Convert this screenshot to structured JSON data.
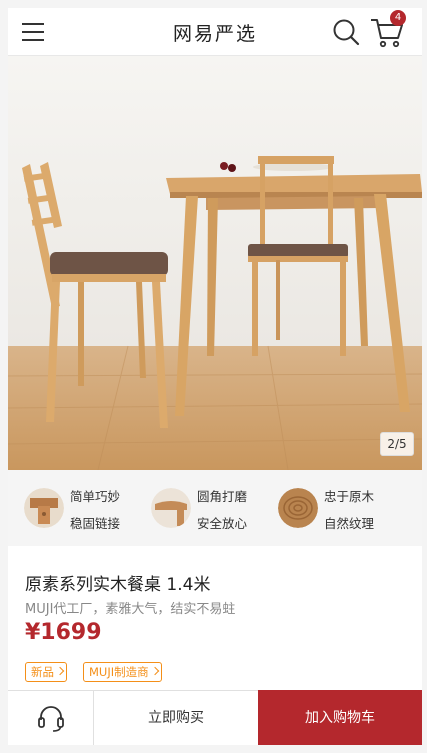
{
  "header": {
    "brand": "网易严选",
    "cart_count": "4"
  },
  "gallery": {
    "pager": "2/5"
  },
  "features": [
    {
      "line1": "简单巧妙",
      "line2": "稳固链接"
    },
    {
      "line1": "圆角打磨",
      "line2": "安全放心"
    },
    {
      "line1": "忠于原木",
      "line2": "自然纹理"
    }
  ],
  "product": {
    "title": "原素系列实木餐桌 1.4米",
    "subtitle": "MUJI代工厂，素雅大气，结实不易蛀",
    "price": "¥1699",
    "tags": [
      "新品",
      "MUJI制造商"
    ]
  },
  "bottom_bar": {
    "buy_now": "立即购买",
    "add_to_cart": "加入购物车"
  },
  "colors": {
    "brand_red": "#b4282d",
    "tag_orange": "#f48f18",
    "wood": "#d9a66b"
  }
}
